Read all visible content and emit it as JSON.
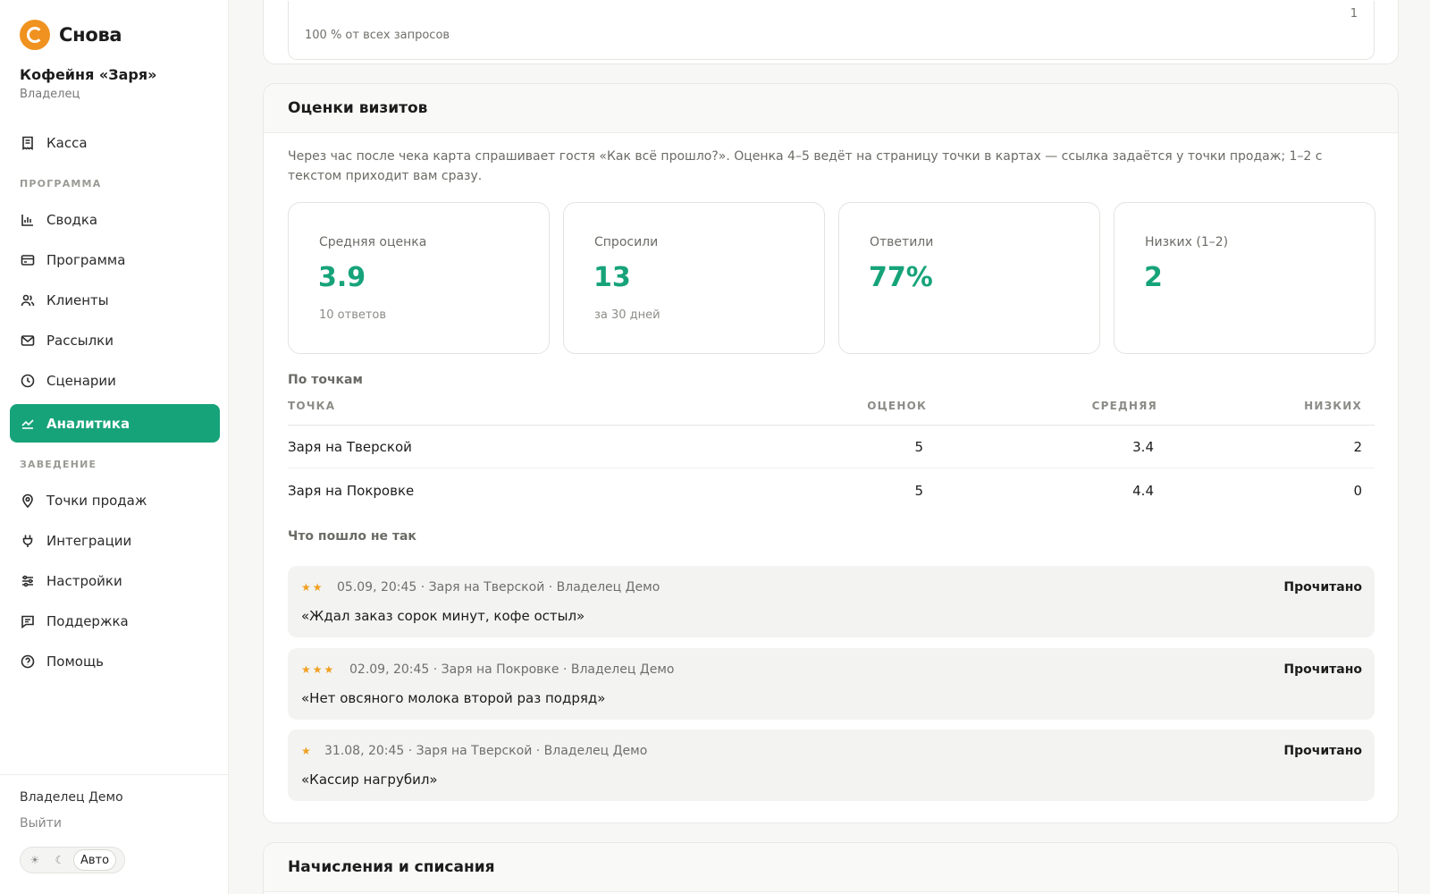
{
  "app": {
    "brand": "Снова"
  },
  "venue": {
    "name": "Кофейня «Заря»",
    "role": "Владелец"
  },
  "sidebar": {
    "top_item": {
      "label": "Касса",
      "icon": "receipt-icon"
    },
    "section_program": "ПРОГРАММА",
    "program_items": [
      {
        "label": "Сводка",
        "icon": "bar-chart-icon"
      },
      {
        "label": "Программа",
        "icon": "card-icon"
      },
      {
        "label": "Клиенты",
        "icon": "users-icon"
      },
      {
        "label": "Рассылки",
        "icon": "mail-icon"
      },
      {
        "label": "Сценарии",
        "icon": "clock-icon"
      },
      {
        "label": "Аналитика",
        "icon": "trend-icon",
        "active": true
      }
    ],
    "section_venue": "ЗАВЕДЕНИЕ",
    "venue_items": [
      {
        "label": "Точки продаж",
        "icon": "map-pin-icon"
      },
      {
        "label": "Интеграции",
        "icon": "plug-icon"
      },
      {
        "label": "Настройки",
        "icon": "sliders-icon"
      },
      {
        "label": "Поддержка",
        "icon": "chat-icon"
      },
      {
        "label": "Помощь",
        "icon": "help-icon"
      }
    ],
    "user": "Владелец Демо",
    "logout": "Выйти",
    "theme": {
      "light": "☀",
      "dark": "☾",
      "auto": "Авто"
    }
  },
  "prev_card": {
    "subtitle": "100 % от всех запросов",
    "count": "1"
  },
  "ratings": {
    "title": "Оценки визитов",
    "intro": "Через час после чека карта спрашивает гостя «Как всё прошло?». Оценка 4–5 ведёт на страницу точки в картах — ссылка задаётся у точки продаж; 1–2 с текстом приходит вам сразу.",
    "stats": [
      {
        "label": "Средняя оценка",
        "value": "3.9",
        "sub": "10 ответов"
      },
      {
        "label": "Спросили",
        "value": "13",
        "sub": "за 30 дней"
      },
      {
        "label": "Ответили",
        "value": "77%",
        "sub": ""
      },
      {
        "label": "Низких (1–2)",
        "value": "2",
        "sub": ""
      }
    ],
    "by_point_title": "По точкам",
    "columns": {
      "point": "ТОЧКА",
      "count": "ОЦЕНОК",
      "avg": "СРЕДНЯЯ",
      "low": "НИЗКИХ"
    },
    "rows": [
      {
        "point": "Заря на Тверской",
        "count": "5",
        "avg": "3.4",
        "low": "2"
      },
      {
        "point": "Заря на Покровке",
        "count": "5",
        "avg": "4.4",
        "low": "0"
      }
    ],
    "issues_title": "Что пошло не так",
    "feedback": [
      {
        "stars": "★★",
        "rating": 2,
        "meta": "05.09, 20:45 · Заря на Тверской · Владелец Демо",
        "text": "«Ждал заказ сорок минут, кофе остыл»",
        "status": "Прочитано"
      },
      {
        "stars": "★★★",
        "rating": 3,
        "meta": "02.09, 20:45 · Заря на Покровке · Владелец Демо",
        "text": "«Нет овсяного молока второй раз подряд»",
        "status": "Прочитано"
      },
      {
        "stars": "★",
        "rating": 1,
        "meta": "31.08, 20:45 · Заря на Тверской · Владелец Демо",
        "text": "«Кассир нагрубил»",
        "status": "Прочитано"
      }
    ]
  },
  "next_card": {
    "title": "Начисления и списания"
  },
  "colors": {
    "accent": "#17a37a",
    "brand": "#f0921f",
    "star": "#f0a020"
  }
}
